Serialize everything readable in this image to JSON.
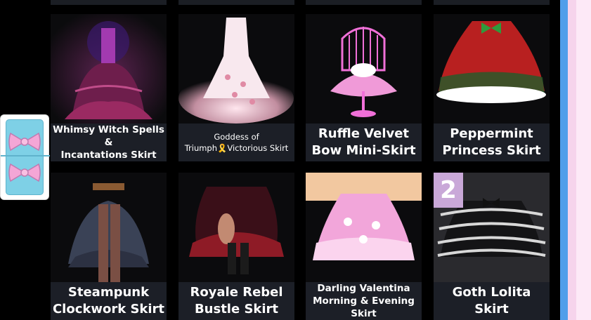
{
  "side_tab": {
    "icons": [
      "bow-icon",
      "bow-icon"
    ]
  },
  "items": [
    {
      "label": "Whimsy Witch Spells &\nIncantations Skirt"
    },
    {
      "label": "Goddess of\nTriumph🎗️Victorious Skirt"
    },
    {
      "label": "Ruffle Velvet\nBow Mini-Skirt"
    },
    {
      "label": "Peppermint\nPrincess Skirt"
    },
    {
      "label": "Steampunk\nClockwork Skirt"
    },
    {
      "label": "Royale Rebel\nBustle Skirt"
    },
    {
      "label": "Darling Valentina\nMorning & Evening Skirt"
    },
    {
      "label": "Goth Lolita Skirt",
      "badge": "2"
    }
  ],
  "colors": {
    "scrollbar": "#55a3ee",
    "tab_background": "#7ed0e6",
    "bow": "#f4a6d6",
    "badge": "#c9a8d8"
  }
}
